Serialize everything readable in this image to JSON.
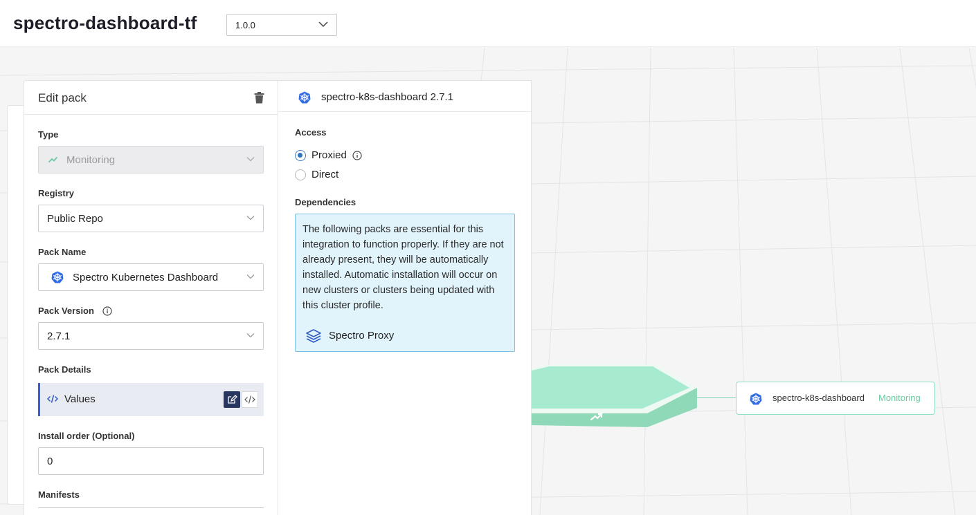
{
  "header": {
    "title": "spectro-dashboard-tf",
    "version_value": "1.0.0"
  },
  "edit_pack": {
    "title": "Edit pack",
    "type_label": "Type",
    "type_value": "Monitoring",
    "registry_label": "Registry",
    "registry_value": "Public Repo",
    "pack_name_label": "Pack Name",
    "pack_name_value": "Spectro Kubernetes Dashboard",
    "pack_version_label": "Pack Version",
    "pack_version_value": "2.7.1",
    "pack_details_label": "Pack Details",
    "values_label": "Values",
    "install_order_label": "Install order (Optional)",
    "install_order_value": "0",
    "manifests_label": "Manifests"
  },
  "pack_info": {
    "title": "spectro-k8s-dashboard 2.7.1",
    "access_label": "Access",
    "access_options": [
      "Proxied",
      "Direct"
    ],
    "access_selected": "Proxied",
    "dependencies_label": "Dependencies",
    "dependencies_text": "The following packs are essential for this integration to function properly. If they are not already present, they will be automatically installed. Automatic installation will occur on new clusters or clusters being updated with this cluster profile.",
    "dependency_item": "Spectro Proxy"
  },
  "canvas": {
    "node_name": "spectro-k8s-dashboard",
    "node_tag": "Monitoring"
  },
  "colors": {
    "accent_blue": "#3b5bdb",
    "k8s_blue": "#326ce5",
    "monitoring_green": "#6cc9a1",
    "hex_green": "#a6ead0"
  }
}
